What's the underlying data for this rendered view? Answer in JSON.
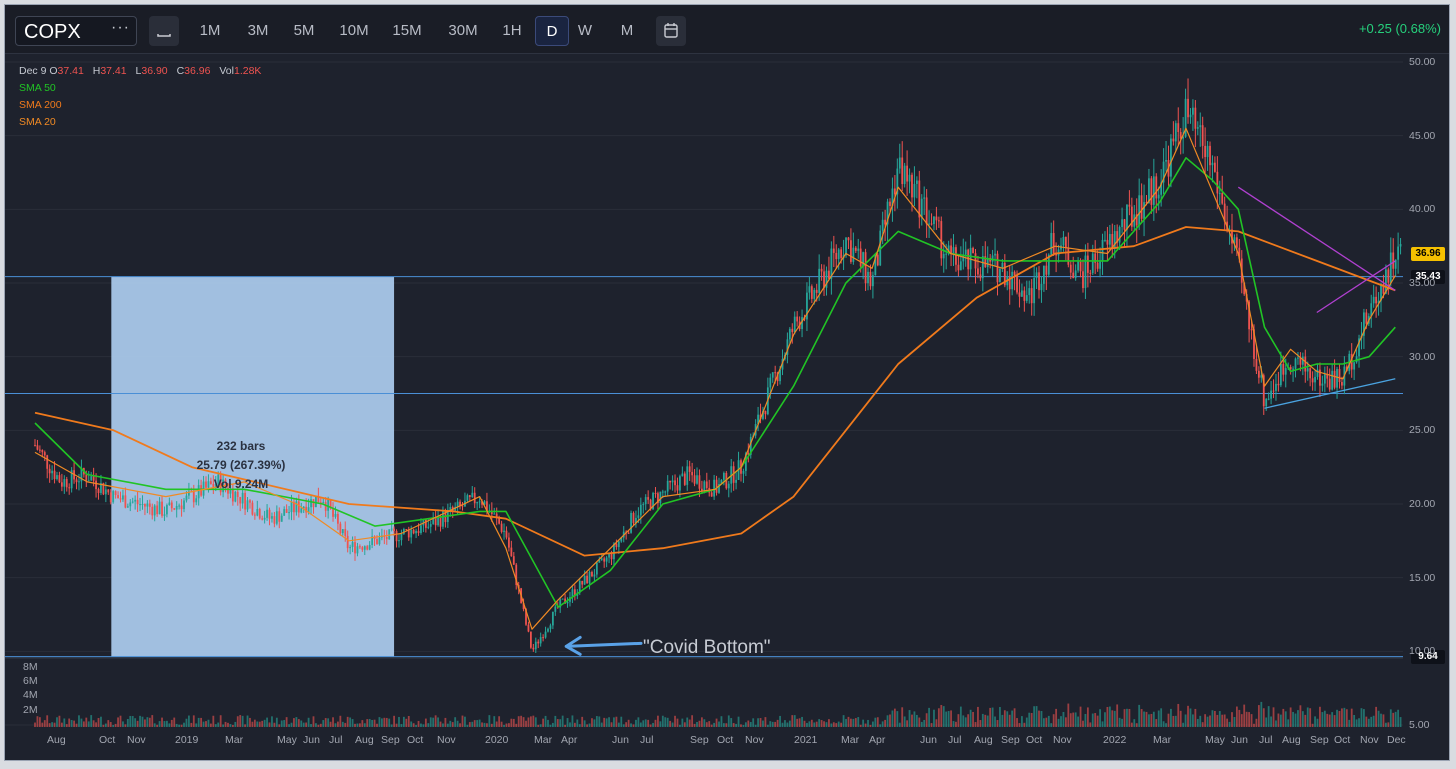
{
  "toolbar": {
    "symbol": "COPX",
    "more_icon": "···",
    "chart_type_icon": "candle-icon",
    "timeframes": [
      "1M",
      "3M",
      "5M",
      "10M",
      "15M",
      "30M",
      "1H",
      "D",
      "W",
      "M"
    ],
    "active_timeframe": "D",
    "calendar_icon": "calendar-icon",
    "change": "+0.25 (0.68%)"
  },
  "legend": {
    "date": "Dec 9",
    "o_label": "O",
    "o_value": "37.41",
    "h_label": "H",
    "h_value": "37.41",
    "l_label": "L",
    "l_value": "36.90",
    "c_label": "C",
    "c_value": "36.96",
    "vol_label": "Vol",
    "vol_value": "1.28K",
    "indicators": [
      {
        "label": "SMA 50",
        "color": "#21c425"
      },
      {
        "label": "SMA 200",
        "color": "#f07a1c"
      },
      {
        "label": "SMA 20",
        "color": "#f08a24"
      }
    ]
  },
  "price_tags": {
    "last": {
      "value": "36.96",
      "bg": "#f5c000",
      "fg": "#000000"
    },
    "level_high": {
      "value": "35.43",
      "bg": "#0e1119",
      "fg": "#ffffff"
    },
    "level_low": {
      "value": "9.64",
      "bg": "#0e1119",
      "fg": "#ffffff"
    }
  },
  "measure": {
    "bars": "232 bars",
    "change": "25.79 (267.39%)",
    "volume": "Vol 9.24M"
  },
  "annotation": "\"Covid Bottom\"",
  "colors": {
    "background": "#1e222d",
    "up": "#26a69a",
    "down": "#ef5350",
    "sma50": "#21c425",
    "sma200": "#f07a1c",
    "sma20": "#f08a24",
    "hline": "#4a8fd6",
    "measure_box": "#a9c8ea",
    "triangle_upper": "#b040d0",
    "triangle_lower": "#4aa3e0"
  },
  "chart_data": {
    "type": "candlestick",
    "ylim": [
      5,
      50
    ],
    "y_ticks": [
      "50.00",
      "45.00",
      "40.00",
      "35.00",
      "30.00",
      "25.00",
      "20.00",
      "15.00",
      "10.00",
      "5.00"
    ],
    "volume_ticks": [
      "8M",
      "6M",
      "4M",
      "2M"
    ],
    "x_ticks": [
      "Aug",
      "Oct",
      "Nov",
      "2019",
      "Mar",
      "May",
      "Jun",
      "Jul",
      "Aug",
      "Sep",
      "Oct",
      "Nov",
      "2020",
      "Mar",
      "Apr",
      "Jun",
      "Jul",
      "Sep",
      "Oct",
      "Nov",
      "2021",
      "Mar",
      "Apr",
      "Jun",
      "Jul",
      "Aug",
      "Sep",
      "Oct",
      "Nov",
      "2022",
      "Mar",
      "May",
      "Jun",
      "Jul",
      "Aug",
      "Sep",
      "Oct",
      "Nov",
      "Dec"
    ],
    "horizontal_levels": [
      35.43,
      27.5,
      9.64
    ],
    "close_path": [
      [
        "2018-08",
        24.0
      ],
      [
        "2018-09",
        21.5
      ],
      [
        "2018-10",
        22.0
      ],
      [
        "2018-11",
        20.5
      ],
      [
        "2019-01",
        19.5
      ],
      [
        "2019-03",
        21.5
      ],
      [
        "2019-05",
        19.0
      ],
      [
        "2019-07",
        20.5
      ],
      [
        "2019-08",
        17.0
      ],
      [
        "2019-09",
        17.5
      ],
      [
        "2019-11",
        18.5
      ],
      [
        "2020-01",
        20.5
      ],
      [
        "2020-02",
        18.0
      ],
      [
        "2020-03",
        10.0
      ],
      [
        "2020-04",
        13.0
      ],
      [
        "2020-06",
        16.5
      ],
      [
        "2020-07",
        19.5
      ],
      [
        "2020-09",
        22.0
      ],
      [
        "2020-10",
        21.0
      ],
      [
        "2020-11",
        22.5
      ],
      [
        "2021-01",
        32.0
      ],
      [
        "2021-03",
        38.0
      ],
      [
        "2021-04",
        35.0
      ],
      [
        "2021-05",
        43.0
      ],
      [
        "2021-06",
        40.0
      ],
      [
        "2021-07",
        36.5
      ],
      [
        "2021-09",
        36.0
      ],
      [
        "2021-10",
        34.0
      ],
      [
        "2021-11",
        38.0
      ],
      [
        "2021-12",
        35.5
      ],
      [
        "2022-01",
        37.5
      ],
      [
        "2022-03",
        42.0
      ],
      [
        "2022-04",
        46.5
      ],
      [
        "2022-05",
        43.0
      ],
      [
        "2022-06",
        36.0
      ],
      [
        "2022-07",
        27.0
      ],
      [
        "2022-08",
        30.0
      ],
      [
        "2022-09",
        28.5
      ],
      [
        "2022-10",
        28.5
      ],
      [
        "2022-11",
        33.0
      ],
      [
        "2022-12",
        36.96
      ]
    ],
    "sma_50": [
      [
        "2018-08",
        25.5
      ],
      [
        "2018-10",
        22.0
      ],
      [
        "2019-01",
        21.0
      ],
      [
        "2019-04",
        21.0
      ],
      [
        "2019-07",
        20.0
      ],
      [
        "2019-09",
        18.5
      ],
      [
        "2020-01",
        19.5
      ],
      [
        "2020-02",
        19.5
      ],
      [
        "2020-04",
        13.0
      ],
      [
        "2020-06",
        15.5
      ],
      [
        "2020-08",
        20.0
      ],
      [
        "2020-10",
        21.0
      ],
      [
        "2020-11",
        22.5
      ],
      [
        "2021-01",
        28.0
      ],
      [
        "2021-03",
        35.0
      ],
      [
        "2021-05",
        38.5
      ],
      [
        "2021-07",
        37.0
      ],
      [
        "2021-09",
        36.5
      ],
      [
        "2021-11",
        36.5
      ],
      [
        "2022-01",
        36.5
      ],
      [
        "2022-03",
        40.5
      ],
      [
        "2022-04",
        43.5
      ],
      [
        "2022-05",
        42.0
      ],
      [
        "2022-06",
        40.0
      ],
      [
        "2022-07",
        32.0
      ],
      [
        "2022-08",
        29.0
      ],
      [
        "2022-09",
        29.5
      ],
      [
        "2022-10",
        29.5
      ],
      [
        "2022-11",
        30.0
      ],
      [
        "2022-12",
        32.0
      ]
    ],
    "sma_200": [
      [
        "2018-08",
        26.2
      ],
      [
        "2018-11",
        25.0
      ],
      [
        "2019-02",
        22.5
      ],
      [
        "2019-08",
        20.0
      ],
      [
        "2019-12",
        19.5
      ],
      [
        "2020-02",
        19.0
      ],
      [
        "2020-05",
        16.5
      ],
      [
        "2020-08",
        17.0
      ],
      [
        "2020-11",
        18.0
      ],
      [
        "2021-01",
        20.5
      ],
      [
        "2021-03",
        25.0
      ],
      [
        "2021-05",
        29.5
      ],
      [
        "2021-08",
        34.0
      ],
      [
        "2021-11",
        37.0
      ],
      [
        "2022-02",
        37.5
      ],
      [
        "2022-04",
        38.8
      ],
      [
        "2022-06",
        38.5
      ],
      [
        "2022-09",
        36.5
      ],
      [
        "2022-12",
        34.5
      ]
    ],
    "sma_20": [
      [
        "2018-08",
        23.5
      ],
      [
        "2018-10",
        21.5
      ],
      [
        "2019-01",
        20.5
      ],
      [
        "2019-04",
        21.5
      ],
      [
        "2019-06",
        20.0
      ],
      [
        "2019-08",
        17.5
      ],
      [
        "2019-10",
        18.0
      ],
      [
        "2020-01",
        20.5
      ],
      [
        "2020-02",
        17.0
      ],
      [
        "2020-03",
        11.5
      ],
      [
        "2020-04",
        13.5
      ],
      [
        "2020-06",
        17.0
      ],
      [
        "2020-08",
        20.5
      ],
      [
        "2020-10",
        21.0
      ],
      [
        "2020-11",
        22.5
      ],
      [
        "2021-01",
        31.5
      ],
      [
        "2021-03",
        37.0
      ],
      [
        "2021-04",
        36.0
      ],
      [
        "2021-05",
        41.5
      ],
      [
        "2021-07",
        37.0
      ],
      [
        "2021-09",
        36.0
      ],
      [
        "2021-11",
        37.5
      ],
      [
        "2022-01",
        37.0
      ],
      [
        "2022-03",
        41.5
      ],
      [
        "2022-04",
        45.5
      ],
      [
        "2022-06",
        37.0
      ],
      [
        "2022-07",
        28.0
      ],
      [
        "2022-08",
        30.5
      ],
      [
        "2022-09",
        29.0
      ],
      [
        "2022-10",
        28.5
      ],
      [
        "2022-11",
        32.5
      ],
      [
        "2022-12",
        35.5
      ]
    ],
    "triangle": {
      "upper_line": [
        [
          "2022-06",
          41.5
        ],
        [
          "2022-12",
          34.5
        ]
      ],
      "lower_line": [
        [
          "2022-07",
          26.5
        ],
        [
          "2022-12",
          28.5
        ]
      ],
      "inner_line": [
        [
          "2022-09",
          33.0
        ],
        [
          "2022-12",
          36.5
        ]
      ]
    },
    "measure_range": {
      "start": "2018-10",
      "end": "2019-09",
      "low": 9.64,
      "high": 35.43
    },
    "annotation_point": [
      "2020-04",
      10.0
    ]
  }
}
